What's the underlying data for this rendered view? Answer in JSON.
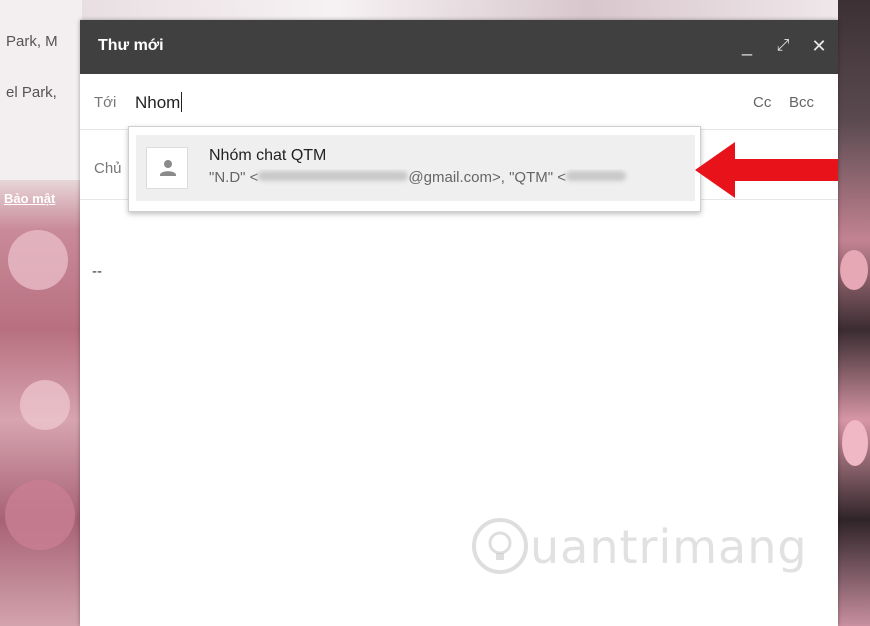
{
  "background_snippets": {
    "line1": "Park, M",
    "line2": "el Park,",
    "link": "Bảo mật"
  },
  "compose": {
    "title": "Thư mới",
    "controls": {
      "minimize": "_",
      "expand": "⤢",
      "close": "✕"
    },
    "to_label": "Tới",
    "to_value": "Nhom",
    "cc_label": "Cc",
    "bcc_label": "Bcc",
    "subject_label": "Chủ",
    "signature": "--"
  },
  "suggestion": {
    "name": "Nhóm chat QTM",
    "detail_prefix": "\"N.D\" <",
    "detail_mid": "@gmail.com>, \"QTM\" <"
  },
  "watermark": {
    "text": "uantrimang"
  },
  "colors": {
    "titlebar": "#404040",
    "arrow": "#e8131a",
    "suggestion_bg": "#efefef"
  },
  "icons": {
    "avatar": "person-icon",
    "annotation": "red-arrow-icon",
    "watermark_logo": "lightbulb-icon"
  }
}
